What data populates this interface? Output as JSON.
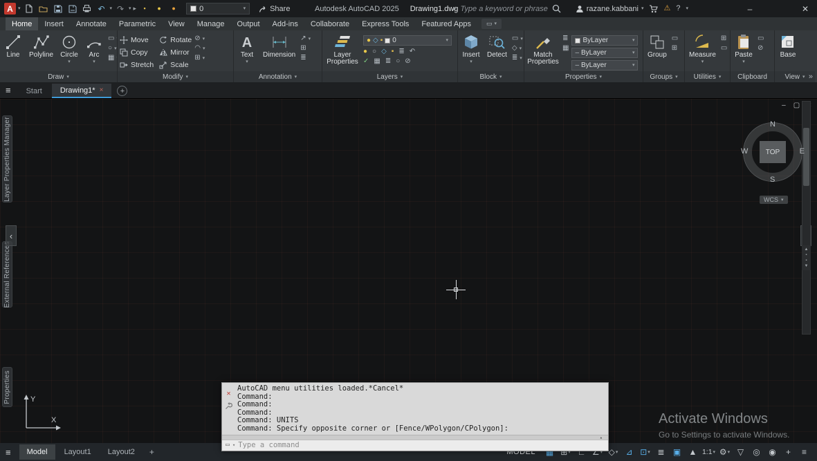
{
  "colors": {
    "accent_blue": "#58aee8",
    "logo_red": "#c3392e",
    "ribbon_bg": "#35393c",
    "canvas_bg": "#131415",
    "command_bg": "#d9d9d9",
    "watermark_gray": "#8e9399",
    "measure_yellow": "#ddb94d",
    "dimension_teal": "#66b8c9"
  },
  "title_bar": {
    "app_title": "Autodesk AutoCAD 2025",
    "doc_title": "Drawing1.dwg",
    "share_label": "Share",
    "search_placeholder": "Type a keyword or phrase",
    "user_name": "razane.kabbani",
    "quick_layer_value": "0"
  },
  "ribbon": {
    "tabs": [
      "Home",
      "Insert",
      "Annotate",
      "Parametric",
      "View",
      "Manage",
      "Output",
      "Add-ins",
      "Collaborate",
      "Express Tools",
      "Featured Apps"
    ],
    "draw": {
      "label": "Draw",
      "buttons": [
        "Line",
        "Polyline",
        "Circle",
        "Arc"
      ]
    },
    "modify": {
      "label": "Modify",
      "buttons": [
        "Move",
        "Rotate",
        "Copy",
        "Mirror",
        "Stretch",
        "Scale"
      ]
    },
    "annotation": {
      "label": "Annotation",
      "buttons": [
        "Text",
        "Dimension"
      ]
    },
    "layers": {
      "label": "Layers",
      "main_button": "Layer Properties",
      "layer_value": "0"
    },
    "block": {
      "label": "Block",
      "buttons": [
        "Insert",
        "Detect"
      ]
    },
    "properties": {
      "label": "Properties",
      "main_button": "Match Properties",
      "color_value": "ByLayer",
      "lineweight_value": "ByLayer",
      "linetype_value": "ByLayer"
    },
    "groups": {
      "label": "Groups",
      "buttons": [
        "Group"
      ]
    },
    "utilities": {
      "label": "Utilities",
      "buttons": [
        "Measure"
      ]
    },
    "clipboard": {
      "label": "Clipboard",
      "buttons": [
        "Paste"
      ]
    },
    "view": {
      "label": "View",
      "buttons": [
        "Base"
      ]
    }
  },
  "file_tabs": {
    "start": "Start",
    "drawing": "Drawing1*"
  },
  "palettes": [
    "Layer Properties Manager",
    "External References",
    "Properties"
  ],
  "viewcube": {
    "north": "N",
    "east": "E",
    "south": "S",
    "west": "W",
    "top": "TOP",
    "wcs": "WCS"
  },
  "ucs": {
    "x": "X",
    "y": "Y"
  },
  "command_window": {
    "lines": [
      "AutoCAD menu utilities loaded.*Cancel*",
      "Command:",
      "Command:",
      "Command:",
      "Command: UNITS",
      "Command: Specify opposite corner or [Fence/WPolygon/CPolygon]:"
    ],
    "input_placeholder": "Type a command"
  },
  "watermark": {
    "title": "Activate Windows",
    "subtitle": "Go to Settings to activate Windows."
  },
  "status_bar": {
    "tabs": [
      "Model",
      "Layout1",
      "Layout2"
    ],
    "space_label": "MODEL",
    "annotation_scale": "1:1"
  },
  "icons": {
    "app_logo": "A",
    "text_tool": "A",
    "caret": "▾",
    "caret_up": "▴",
    "arrow_right": "▸",
    "overflow": "»",
    "undo": "↶",
    "redo": "↷",
    "minimize": "–",
    "maximize": "▢",
    "close": "✕",
    "close_small": "×",
    "hamburger": "≡",
    "plus": "+",
    "help": "?",
    "alert": "⚠",
    "chevron_left": "‹",
    "chevron_right": "›",
    "up_triangle": "▲",
    "down_triangle": "▼",
    "mini_square": "▪",
    "grid": "▦",
    "snap": "⊞",
    "ortho": "∟",
    "polar": "∠",
    "isodraft": "◇",
    "otrack": "⊿",
    "osnap": "⊡",
    "lineweight": "≣",
    "cycling": "▣",
    "annotation_vis": "▲",
    "gear": "⚙",
    "filter": "▽",
    "monitor": "◎",
    "isolate": "◉",
    "mini_rect": "▭",
    "mini_circle": "○",
    "mini_grid": "▦",
    "mini_lines": "≣",
    "mini_plus": "⊞",
    "mini_diamond": "◇",
    "mini_arc": "◠",
    "mini_dot": "●",
    "mini_check": "✓",
    "mini_slash": "⊘",
    "mini_arrow": "↗"
  }
}
